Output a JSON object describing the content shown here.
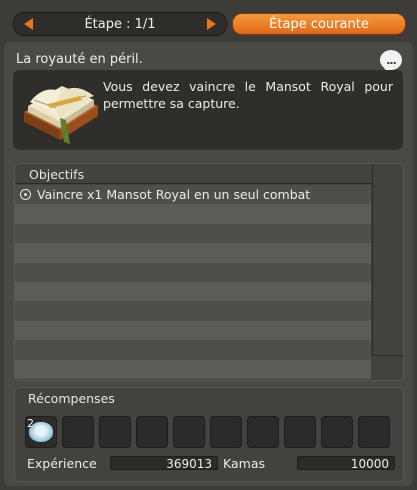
{
  "step_nav": {
    "label": "Étape : 1/1",
    "current_button": "Étape courante"
  },
  "quest": {
    "title": "La royauté en péril.",
    "description": "Vous devez vaincre le Mansot Royal pour permettre sa capture.",
    "icon": "quest-book-icon",
    "chat_icon": "..."
  },
  "objectives": {
    "header": "Objectifs",
    "items": [
      {
        "label": "Vaincre x1 Mansot Royal en un seul combat",
        "icon": "target-icon"
      }
    ]
  },
  "rewards": {
    "header": "Récompenses",
    "slots": [
      {
        "item": "item-icon",
        "quantity": "2"
      },
      {},
      {},
      {},
      {},
      {},
      {},
      {},
      {},
      {}
    ],
    "experience_label": "Expérience",
    "experience_value": "369013",
    "kamas_label": "Kamas",
    "kamas_value": "10000"
  },
  "colors": {
    "accent": "#e87a1e",
    "background": "#3d3c38"
  }
}
